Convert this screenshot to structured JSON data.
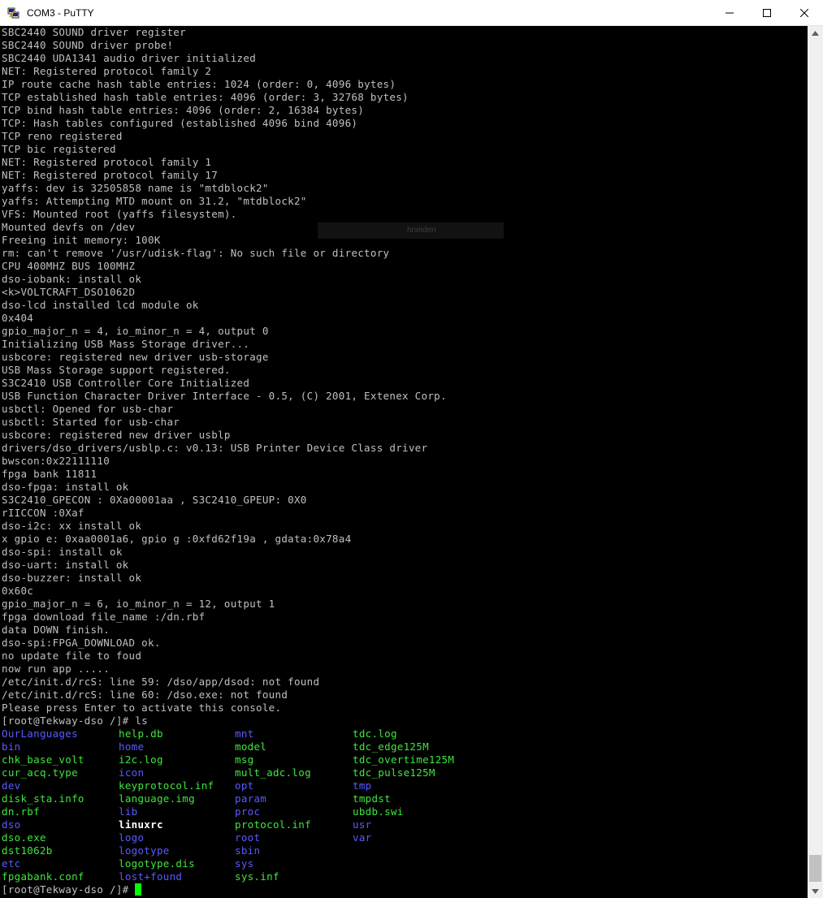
{
  "window": {
    "title": "COM3 - PuTTY"
  },
  "colors": {
    "directory": "#5a5aff",
    "executable": "#3ee63e",
    "cursor": "#00ff00",
    "text": "#c0c0c0"
  },
  "terminal": {
    "lines": [
      "SBC2440 SOUND driver register",
      "SBC2440 SOUND driver probe!",
      "SBC2440 UDA1341 audio driver initialized",
      "NET: Registered protocol family 2",
      "IP route cache hash table entries: 1024 (order: 0, 4096 bytes)",
      "TCP established hash table entries: 4096 (order: 3, 32768 bytes)",
      "TCP bind hash table entries: 4096 (order: 2, 16384 bytes)",
      "TCP: Hash tables configured (established 4096 bind 4096)",
      "TCP reno registered",
      "TCP bic registered",
      "NET: Registered protocol family 1",
      "NET: Registered protocol family 17",
      "yaffs: dev is 32505858 name is \"mtdblock2\"",
      "yaffs: Attempting MTD mount on 31.2, \"mtdblock2\"",
      "VFS: Mounted root (yaffs filesystem).",
      "Mounted devfs on /dev",
      "Freeing init memory: 100K",
      "rm: can't remove '/usr/udisk-flag': No such file or directory",
      "CPU 400MHZ BUS 100MHZ",
      "dso-iobank: install ok",
      "<k>VOLTCRAFT_DSO1062D",
      "dso-lcd installed lcd module ok",
      "0x404",
      "gpio_major_n = 4, io_minor_n = 4, output 0",
      "Initializing USB Mass Storage driver...",
      "usbcore: registered new driver usb-storage",
      "USB Mass Storage support registered.",
      "S3C2410 USB Controller Core Initialized",
      "USB Function Character Driver Interface - 0.5, (C) 2001, Extenex Corp.",
      "usbctl: Opened for usb-char",
      "usbctl: Started for usb-char",
      "usbcore: registered new driver usblp",
      "drivers/dso_drivers/usblp.c: v0.13: USB Printer Device Class driver",
      "bwscon:0x22111110",
      "fpga bank 11811",
      "dso-fpga: install ok",
      "S3C2410_GPECON : 0Xa00001aa , S3C2410_GPEUP: 0X0",
      "rIICCON :0Xaf",
      "dso-i2c: xx install ok",
      "x gpio e: 0xaa0001a6, gpio g :0xfd62f19a , gdata:0x78a4",
      "dso-spi: install ok",
      "dso-uart: install ok",
      "dso-buzzer: install ok",
      "0x60c",
      "gpio_major_n = 6, io_minor_n = 12, output 1",
      "fpga download file_name :/dn.rbf",
      "data DOWN finish.",
      "dso-spi:FPGA_DOWNLOAD ok.",
      "no update file to foud",
      "now run app .....",
      "/etc/init.d/rcS: line 59: /dso/app/dsod: not found",
      "/etc/init.d/rcS: line 60: /dso.exe: not found",
      "Please press Enter to activate this console.",
      "[root@Tekway-dso /]# ls"
    ],
    "ls_rows": [
      [
        {
          "t": "OurLanguages",
          "k": "dir"
        },
        {
          "t": "help.db",
          "k": "exec"
        },
        {
          "t": "mnt",
          "k": "dir"
        },
        {
          "t": "tdc.log",
          "k": "exec"
        }
      ],
      [
        {
          "t": "bin",
          "k": "dir"
        },
        {
          "t": "home",
          "k": "dir"
        },
        {
          "t": "model",
          "k": "exec"
        },
        {
          "t": "tdc_edge125M",
          "k": "exec"
        }
      ],
      [
        {
          "t": "chk_base_volt",
          "k": "exec"
        },
        {
          "t": "i2c.log",
          "k": "exec"
        },
        {
          "t": "msg",
          "k": "exec"
        },
        {
          "t": "tdc_overtime125M",
          "k": "exec"
        }
      ],
      [
        {
          "t": "cur_acq.type",
          "k": "exec"
        },
        {
          "t": "icon",
          "k": "dir"
        },
        {
          "t": "mult_adc.log",
          "k": "exec"
        },
        {
          "t": "tdc_pulse125M",
          "k": "exec"
        }
      ],
      [
        {
          "t": "dev",
          "k": "dir"
        },
        {
          "t": "keyprotocol.inf",
          "k": "exec"
        },
        {
          "t": "opt",
          "k": "dir"
        },
        {
          "t": "tmp",
          "k": "dir"
        }
      ],
      [
        {
          "t": "disk_sta.info",
          "k": "exec"
        },
        {
          "t": "language.img",
          "k": "exec"
        },
        {
          "t": "param",
          "k": "dir"
        },
        {
          "t": "tmpdst",
          "k": "exec"
        }
      ],
      [
        {
          "t": "dn.rbf",
          "k": "exec"
        },
        {
          "t": "lib",
          "k": "dir"
        },
        {
          "t": "proc",
          "k": "dir"
        },
        {
          "t": "ubdb.swi",
          "k": "exec"
        }
      ],
      [
        {
          "t": "dso",
          "k": "dir"
        },
        {
          "t": "linuxrc",
          "k": "bold"
        },
        {
          "t": "protocol.inf",
          "k": "exec"
        },
        {
          "t": "usr",
          "k": "dir"
        }
      ],
      [
        {
          "t": "dso.exe",
          "k": "exec"
        },
        {
          "t": "logo",
          "k": "dir"
        },
        {
          "t": "root",
          "k": "dir"
        },
        {
          "t": "var",
          "k": "dir"
        }
      ],
      [
        {
          "t": "dst1062b",
          "k": "exec"
        },
        {
          "t": "logotype",
          "k": "dir"
        },
        {
          "t": "sbin",
          "k": "dir"
        },
        {
          "t": "",
          "k": "file"
        }
      ],
      [
        {
          "t": "etc",
          "k": "dir"
        },
        {
          "t": "logotype.dis",
          "k": "exec"
        },
        {
          "t": "sys",
          "k": "dir"
        },
        {
          "t": "",
          "k": "file"
        }
      ],
      [
        {
          "t": "fpgabank.conf",
          "k": "exec"
        },
        {
          "t": "lost+found",
          "k": "dir"
        },
        {
          "t": "sys.inf",
          "k": "exec"
        },
        {
          "t": "",
          "k": "file"
        }
      ]
    ],
    "prompt": "[root@Tekway-dso /]# "
  },
  "ghost_tooltip": "hneiden"
}
